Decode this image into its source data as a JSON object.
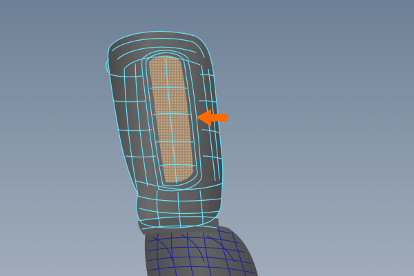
{
  "viewport": {
    "background_top": "#6e8096",
    "background_bottom": "#a0acba"
  },
  "model": {
    "type": "polygon mesh (upper arm / sleeve)",
    "surface_color": "#5f5f5f",
    "wire_color_selected": "#5fe3ff",
    "wire_color_lower": "#1d1fa8",
    "selected_faces_color": "#a88a6a"
  },
  "annotation": {
    "icon": "arrow-left-icon",
    "color": "#ff6a00"
  }
}
